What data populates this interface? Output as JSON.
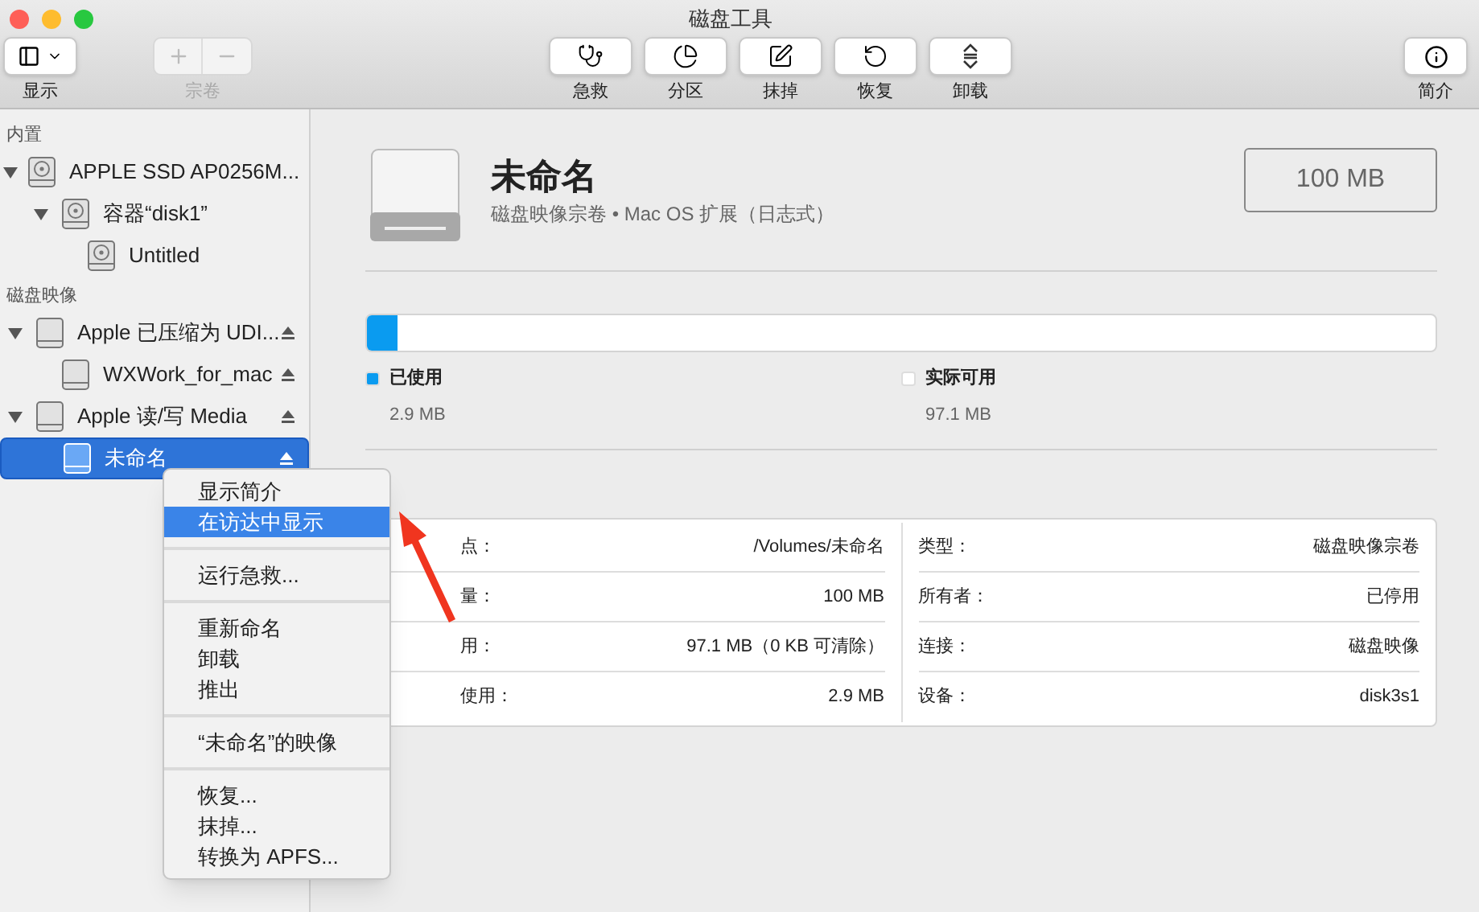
{
  "window": {
    "title": "磁盘工具"
  },
  "toolbar": {
    "view": {
      "label": "显示"
    },
    "volume": {
      "label": "宗卷",
      "disabled": true
    },
    "actions": [
      {
        "kind": "firstaid",
        "label": "急救"
      },
      {
        "kind": "partition",
        "label": "分区"
      },
      {
        "kind": "erase",
        "label": "抹掉"
      },
      {
        "kind": "restore",
        "label": "恢复"
      },
      {
        "kind": "unmount",
        "label": "卸载"
      }
    ],
    "info": {
      "label": "简介"
    }
  },
  "sidebar": {
    "sections": [
      {
        "title": "内置",
        "items": [
          {
            "label": "APPLE SSD AP0256M...",
            "kind": "internal",
            "expanded": true,
            "selected": false,
            "children": [
              {
                "label": "容器“disk1”",
                "kind": "internal",
                "expanded": true,
                "selected": false,
                "children": [
                  {
                    "label": "Untitled",
                    "kind": "internal",
                    "selected": false
                  }
                ]
              }
            ]
          }
        ]
      },
      {
        "title": "磁盘映像",
        "items": [
          {
            "label": "Apple 已压缩为 UDI...",
            "kind": "image",
            "expanded": true,
            "selected": false,
            "eject": true,
            "children": [
              {
                "label": "WXWork_for_mac",
                "kind": "image",
                "selected": false,
                "eject": true
              }
            ]
          },
          {
            "label": "Apple 读/写 Media",
            "kind": "image",
            "expanded": true,
            "selected": false,
            "eject": true,
            "children": [
              {
                "label": "未命名",
                "kind": "image",
                "selected": true,
                "eject": true
              }
            ]
          }
        ]
      }
    ]
  },
  "volume": {
    "name": "未命名",
    "subtitle": "磁盘映像宗卷 • Mac OS 扩展（日志式）",
    "size": "100 MB"
  },
  "usage": {
    "level": 0.029,
    "legend": [
      {
        "label": "已使用",
        "value": "2.9 MB",
        "color": "#0a9bf0"
      },
      {
        "label": "实际可用",
        "value": "97.1 MB",
        "color": "#ffffff"
      }
    ]
  },
  "info_table": {
    "left": [
      {
        "label": "点：",
        "value": "/Volumes/未命名"
      },
      {
        "label": "量：",
        "value": "100 MB"
      },
      {
        "label": "用：",
        "value": "97.1 MB（0 KB 可清除）"
      },
      {
        "label": "使用：",
        "value": "2.9 MB"
      }
    ],
    "right": [
      {
        "label": "类型：",
        "value": "磁盘映像宗卷"
      },
      {
        "label": "所有者：",
        "value": "已停用"
      },
      {
        "label": "连接：",
        "value": "磁盘映像"
      },
      {
        "label": "设备：",
        "value": "disk3s1"
      }
    ]
  },
  "context_menu": {
    "groups": [
      [
        {
          "label": "显示简介",
          "selected": false
        },
        {
          "label": "在访达中显示",
          "selected": true
        }
      ],
      [
        {
          "label": "运行急救...",
          "selected": false
        }
      ],
      [
        {
          "label": "重新命名",
          "selected": false
        },
        {
          "label": "卸载",
          "selected": false
        },
        {
          "label": "推出",
          "selected": false
        }
      ],
      [
        {
          "label": "“未命名”的映像",
          "selected": false
        }
      ],
      [
        {
          "label": "恢复...",
          "selected": false
        },
        {
          "label": "抹掉...",
          "selected": false
        },
        {
          "label": "转换为 APFS...",
          "selected": false
        }
      ]
    ]
  }
}
